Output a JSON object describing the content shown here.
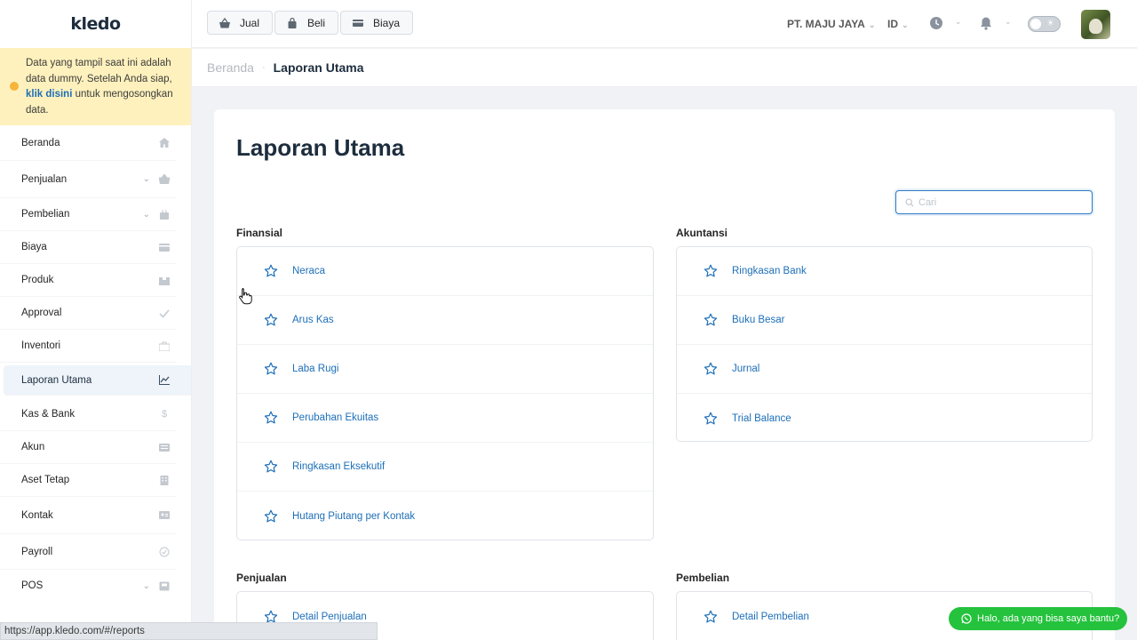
{
  "app": {
    "logo": "kledo"
  },
  "notice": {
    "text_before": "Data yang tampil saat ini adalah data dummy. Setelah Anda siap, ",
    "link": "klik disini",
    "text_after": " untuk mengosongkan data."
  },
  "sidebar": {
    "items": [
      {
        "label": "Beranda",
        "icon": "home-icon"
      },
      {
        "label": "Penjualan",
        "icon": "basket-icon",
        "expandable": true
      },
      {
        "label": "Pembelian",
        "icon": "bag-icon",
        "expandable": true
      },
      {
        "label": "Biaya",
        "icon": "card-icon"
      },
      {
        "label": "Produk",
        "icon": "box-icon"
      },
      {
        "label": "Approval",
        "icon": "check-icon"
      },
      {
        "label": "Inventori",
        "icon": "briefcase-icon"
      },
      {
        "label": "Laporan Utama",
        "icon": "chart-icon",
        "active": true
      },
      {
        "label": "Kas & Bank",
        "icon": "dollar-icon"
      },
      {
        "label": "Akun",
        "icon": "ledger-icon"
      },
      {
        "label": "Aset Tetap",
        "icon": "building-icon"
      },
      {
        "label": "Kontak",
        "icon": "contact-card-icon"
      },
      {
        "label": "Payroll",
        "icon": "check-circle-icon"
      },
      {
        "label": "POS",
        "icon": "pos-icon",
        "expandable": true
      }
    ]
  },
  "topbar": {
    "buttons": {
      "sell": "Jual",
      "buy": "Beli",
      "expense": "Biaya"
    },
    "company": "PT. MAJU JAYA",
    "language": "ID"
  },
  "breadcrumb": {
    "home": "Beranda",
    "current": "Laporan Utama"
  },
  "main": {
    "title": "Laporan Utama",
    "search_placeholder": "Cari",
    "sections": {
      "finansial": {
        "title": "Finansial",
        "items": [
          "Neraca",
          "Arus Kas",
          "Laba Rugi",
          "Perubahan Ekuitas",
          "Ringkasan Eksekutif",
          "Hutang Piutang per Kontak"
        ]
      },
      "akuntansi": {
        "title": "Akuntansi",
        "items": [
          "Ringkasan Bank",
          "Buku Besar",
          "Jurnal",
          "Trial Balance"
        ]
      },
      "penjualan": {
        "title": "Penjualan",
        "items": [
          "Detail Penjualan"
        ]
      },
      "pembelian": {
        "title": "Pembelian",
        "items": [
          "Detail Pembelian"
        ]
      }
    }
  },
  "status_url": "https://app.kledo.com/#/reports",
  "whatsapp": {
    "label": "Halo, ada yang bisa saya bantu?"
  },
  "colors": {
    "accent": "#1d6fb8",
    "notice_bg": "#fef1bd",
    "whatsapp": "#25c23d"
  }
}
